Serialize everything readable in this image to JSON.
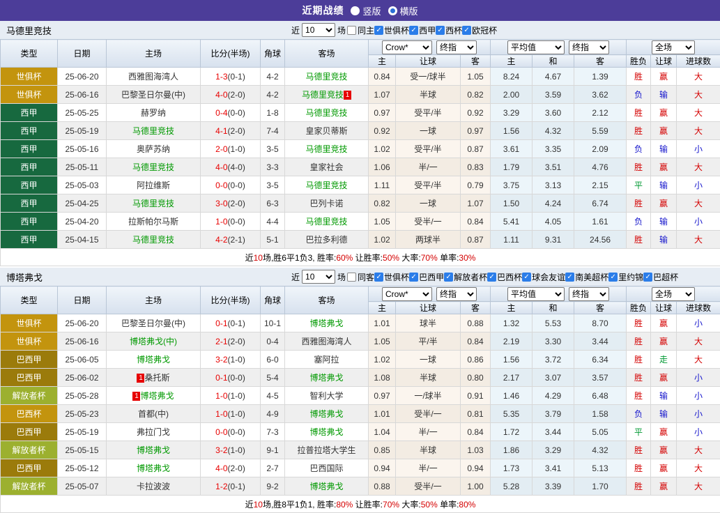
{
  "topbar": {
    "title": "近期战绩",
    "radios": [
      {
        "label": "竖版",
        "selected": false
      },
      {
        "label": "横版",
        "selected": true
      }
    ]
  },
  "colors": {
    "topbar_purple": "#4c3d99",
    "league_gold": "#c3940e",
    "league_green": "#17693f",
    "league_bronze": "#9b7b0b",
    "league_yellowgreen": "#9cb02f",
    "team_highlight_green": "#009900",
    "score_red": "#e80000",
    "result_red": "#d40000",
    "result_blue": "#1515cc",
    "result_green": "#009933"
  },
  "columns": {
    "type": "类型",
    "date": "日期",
    "home": "主场",
    "score": "比分(半场)",
    "corner": "角球",
    "away": "客场"
  },
  "dropdowns": {
    "crow": "Crow*",
    "final1": "终指",
    "avg": "平均值",
    "final2": "终指",
    "full": "全场"
  },
  "subheader": [
    "主",
    "让球",
    "客",
    "主",
    "和",
    "客",
    "胜负",
    "让球",
    "进球数"
  ],
  "filter_labels": {
    "near": "近",
    "games": "场"
  },
  "sections": [
    {
      "team": "马德里竞技",
      "filter": {
        "count": "10",
        "venue_label": "同主",
        "venue_checked": false,
        "leagues": [
          "世俱杯",
          "西甲",
          "西杯",
          "欧冠杯"
        ]
      },
      "rows": [
        {
          "league": "世俱杯",
          "lc": "gold",
          "date": "25-06-20",
          "home": "西雅图海湾人",
          "home_hl": false,
          "home_badge": "",
          "score": "1-3",
          "half": "(0-1)",
          "corner": "4-2",
          "away": "马德里竞技",
          "away_hl": true,
          "away_badge": "",
          "odds": [
            "0.84",
            "受一/球半",
            "1.05"
          ],
          "avg": [
            "8.24",
            "4.67",
            "1.39"
          ],
          "res": [
            [
              "胜",
              "r"
            ],
            [
              "赢",
              "r"
            ],
            [
              "大",
              "r"
            ]
          ]
        },
        {
          "league": "世俱杯",
          "lc": "gold",
          "date": "25-06-16",
          "home": "巴黎圣日尔曼(中)",
          "home_hl": false,
          "home_badge": "",
          "score": "4-0",
          "half": "(2-0)",
          "corner": "4-2",
          "away": "马德里竞技",
          "away_hl": true,
          "away_badge": "1",
          "odds": [
            "1.07",
            "半球",
            "0.82"
          ],
          "avg": [
            "2.00",
            "3.59",
            "3.62"
          ],
          "res": [
            [
              "负",
              "b"
            ],
            [
              "输",
              "b"
            ],
            [
              "大",
              "r"
            ]
          ]
        },
        {
          "league": "西甲",
          "lc": "green",
          "date": "25-05-25",
          "home": "赫罗纳",
          "home_hl": false,
          "home_badge": "",
          "score": "0-4",
          "half": "(0-0)",
          "corner": "1-8",
          "away": "马德里竞技",
          "away_hl": true,
          "away_badge": "",
          "odds": [
            "0.97",
            "受平/半",
            "0.92"
          ],
          "avg": [
            "3.29",
            "3.60",
            "2.12"
          ],
          "res": [
            [
              "胜",
              "r"
            ],
            [
              "赢",
              "r"
            ],
            [
              "大",
              "r"
            ]
          ]
        },
        {
          "league": "西甲",
          "lc": "green",
          "date": "25-05-19",
          "home": "马德里竞技",
          "home_hl": true,
          "home_badge": "",
          "score": "4-1",
          "half": "(2-0)",
          "corner": "7-4",
          "away": "皇家贝蒂斯",
          "away_hl": false,
          "away_badge": "",
          "odds": [
            "0.92",
            "一球",
            "0.97"
          ],
          "avg": [
            "1.56",
            "4.32",
            "5.59"
          ],
          "res": [
            [
              "胜",
              "r"
            ],
            [
              "赢",
              "r"
            ],
            [
              "大",
              "r"
            ]
          ]
        },
        {
          "league": "西甲",
          "lc": "green",
          "date": "25-05-16",
          "home": "奥萨苏纳",
          "home_hl": false,
          "home_badge": "",
          "score": "2-0",
          "half": "(1-0)",
          "corner": "3-5",
          "away": "马德里竞技",
          "away_hl": true,
          "away_badge": "",
          "odds": [
            "1.02",
            "受平/半",
            "0.87"
          ],
          "avg": [
            "3.61",
            "3.35",
            "2.09"
          ],
          "res": [
            [
              "负",
              "b"
            ],
            [
              "输",
              "b"
            ],
            [
              "小",
              "b"
            ]
          ]
        },
        {
          "league": "西甲",
          "lc": "green",
          "date": "25-05-11",
          "home": "马德里竞技",
          "home_hl": true,
          "home_badge": "",
          "score": "4-0",
          "half": "(4-0)",
          "corner": "3-3",
          "away": "皇家社会",
          "away_hl": false,
          "away_badge": "",
          "odds": [
            "1.06",
            "半/一",
            "0.83"
          ],
          "avg": [
            "1.79",
            "3.51",
            "4.76"
          ],
          "res": [
            [
              "胜",
              "r"
            ],
            [
              "赢",
              "r"
            ],
            [
              "大",
              "r"
            ]
          ]
        },
        {
          "league": "西甲",
          "lc": "green",
          "date": "25-05-03",
          "home": "阿拉维斯",
          "home_hl": false,
          "home_badge": "",
          "score": "0-0",
          "half": "(0-0)",
          "corner": "3-5",
          "away": "马德里竞技",
          "away_hl": true,
          "away_badge": "",
          "odds": [
            "1.11",
            "受平/半",
            "0.79"
          ],
          "avg": [
            "3.75",
            "3.13",
            "2.15"
          ],
          "res": [
            [
              "平",
              "g"
            ],
            [
              "输",
              "b"
            ],
            [
              "小",
              "b"
            ]
          ]
        },
        {
          "league": "西甲",
          "lc": "green",
          "date": "25-04-25",
          "home": "马德里竞技",
          "home_hl": true,
          "home_badge": "",
          "score": "3-0",
          "half": "(2-0)",
          "corner": "6-3",
          "away": "巴列卡诺",
          "away_hl": false,
          "away_badge": "",
          "odds": [
            "0.82",
            "一球",
            "1.07"
          ],
          "avg": [
            "1.50",
            "4.24",
            "6.74"
          ],
          "res": [
            [
              "胜",
              "r"
            ],
            [
              "赢",
              "r"
            ],
            [
              "大",
              "r"
            ]
          ]
        },
        {
          "league": "西甲",
          "lc": "green",
          "date": "25-04-20",
          "home": "拉斯帕尔马斯",
          "home_hl": false,
          "home_badge": "",
          "score": "1-0",
          "half": "(0-0)",
          "corner": "4-4",
          "away": "马德里竞技",
          "away_hl": true,
          "away_badge": "",
          "odds": [
            "1.05",
            "受半/一",
            "0.84"
          ],
          "avg": [
            "5.41",
            "4.05",
            "1.61"
          ],
          "res": [
            [
              "负",
              "b"
            ],
            [
              "输",
              "b"
            ],
            [
              "小",
              "b"
            ]
          ]
        },
        {
          "league": "西甲",
          "lc": "green",
          "date": "25-04-15",
          "home": "马德里竞技",
          "home_hl": true,
          "home_badge": "",
          "score": "4-2",
          "half": "(2-1)",
          "corner": "5-1",
          "away": "巴拉多利德",
          "away_hl": false,
          "away_badge": "",
          "odds": [
            "1.02",
            "两球半",
            "0.87"
          ],
          "avg": [
            "1.11",
            "9.31",
            "24.56"
          ],
          "res": [
            [
              "胜",
              "r"
            ],
            [
              "输",
              "b"
            ],
            [
              "大",
              "r"
            ]
          ]
        }
      ],
      "summary": [
        [
          "近",
          "k"
        ],
        [
          "10",
          "r"
        ],
        [
          "场,胜6平1负3, 胜率:",
          "k"
        ],
        [
          "60%",
          "r"
        ],
        [
          " 让胜率:",
          "k"
        ],
        [
          "50%",
          "r"
        ],
        [
          " 大率:",
          "k"
        ],
        [
          "70%",
          "r"
        ],
        [
          " 单率:",
          "k"
        ],
        [
          "30%",
          "r"
        ]
      ]
    },
    {
      "team": "博塔弗戈",
      "filter": {
        "count": "10",
        "venue_label": "同客",
        "venue_checked": false,
        "leagues": [
          "世俱杯",
          "巴西甲",
          "解放者杯",
          "巴西杯",
          "球会友谊",
          "南美超杯",
          "里约锦",
          "巴超杯"
        ]
      },
      "rows": [
        {
          "league": "世俱杯",
          "lc": "gold",
          "date": "25-06-20",
          "home": "巴黎圣日尔曼(中)",
          "home_hl": false,
          "home_badge": "",
          "score": "0-1",
          "half": "(0-1)",
          "corner": "10-1",
          "away": "博塔弗戈",
          "away_hl": true,
          "away_badge": "",
          "odds": [
            "1.01",
            "球半",
            "0.88"
          ],
          "avg": [
            "1.32",
            "5.53",
            "8.70"
          ],
          "res": [
            [
              "胜",
              "r"
            ],
            [
              "赢",
              "r"
            ],
            [
              "小",
              "b"
            ]
          ]
        },
        {
          "league": "世俱杯",
          "lc": "gold",
          "date": "25-06-16",
          "home": "博塔弗戈(中)",
          "home_hl": true,
          "home_badge": "",
          "score": "2-1",
          "half": "(2-0)",
          "corner": "0-4",
          "away": "西雅图海湾人",
          "away_hl": false,
          "away_badge": "",
          "odds": [
            "1.05",
            "平/半",
            "0.84"
          ],
          "avg": [
            "2.19",
            "3.30",
            "3.44"
          ],
          "res": [
            [
              "胜",
              "r"
            ],
            [
              "赢",
              "r"
            ],
            [
              "大",
              "r"
            ]
          ]
        },
        {
          "league": "巴西甲",
          "lc": "bronze",
          "date": "25-06-05",
          "home": "博塔弗戈",
          "home_hl": true,
          "home_badge": "",
          "score": "3-2",
          "half": "(1-0)",
          "corner": "6-0",
          "away": "塞阿拉",
          "away_hl": false,
          "away_badge": "",
          "odds": [
            "1.02",
            "一球",
            "0.86"
          ],
          "avg": [
            "1.56",
            "3.72",
            "6.34"
          ],
          "res": [
            [
              "胜",
              "r"
            ],
            [
              "走",
              "g"
            ],
            [
              "大",
              "r"
            ]
          ]
        },
        {
          "league": "巴西甲",
          "lc": "bronze",
          "date": "25-06-02",
          "home": "桑托斯",
          "home_hl": false,
          "home_badge": "1",
          "score": "0-1",
          "half": "(0-0)",
          "corner": "5-4",
          "away": "博塔弗戈",
          "away_hl": true,
          "away_badge": "",
          "odds": [
            "1.08",
            "半球",
            "0.80"
          ],
          "avg": [
            "2.17",
            "3.07",
            "3.57"
          ],
          "res": [
            [
              "胜",
              "r"
            ],
            [
              "赢",
              "r"
            ],
            [
              "小",
              "b"
            ]
          ]
        },
        {
          "league": "解放者杯",
          "lc": "yg",
          "date": "25-05-28",
          "home": "博塔弗戈",
          "home_hl": true,
          "home_badge": "1",
          "score": "1-0",
          "half": "(1-0)",
          "corner": "4-5",
          "away": "智利大学",
          "away_hl": false,
          "away_badge": "",
          "odds": [
            "0.97",
            "一/球半",
            "0.91"
          ],
          "avg": [
            "1.46",
            "4.29",
            "6.48"
          ],
          "res": [
            [
              "胜",
              "r"
            ],
            [
              "输",
              "b"
            ],
            [
              "小",
              "b"
            ]
          ]
        },
        {
          "league": "巴西杯",
          "lc": "gold",
          "date": "25-05-23",
          "home": "首都(中)",
          "home_hl": false,
          "home_badge": "",
          "score": "1-0",
          "half": "(1-0)",
          "corner": "4-9",
          "away": "博塔弗戈",
          "away_hl": true,
          "away_badge": "",
          "odds": [
            "1.01",
            "受半/一",
            "0.81"
          ],
          "avg": [
            "5.35",
            "3.79",
            "1.58"
          ],
          "res": [
            [
              "负",
              "b"
            ],
            [
              "输",
              "b"
            ],
            [
              "小",
              "b"
            ]
          ]
        },
        {
          "league": "巴西甲",
          "lc": "bronze",
          "date": "25-05-19",
          "home": "弗拉门戈",
          "home_hl": false,
          "home_badge": "",
          "score": "0-0",
          "half": "(0-0)",
          "corner": "7-3",
          "away": "博塔弗戈",
          "away_hl": true,
          "away_badge": "",
          "odds": [
            "1.04",
            "半/一",
            "0.84"
          ],
          "avg": [
            "1.72",
            "3.44",
            "5.05"
          ],
          "res": [
            [
              "平",
              "g"
            ],
            [
              "赢",
              "r"
            ],
            [
              "小",
              "b"
            ]
          ]
        },
        {
          "league": "解放者杯",
          "lc": "yg",
          "date": "25-05-15",
          "home": "博塔弗戈",
          "home_hl": true,
          "home_badge": "",
          "score": "3-2",
          "half": "(1-0)",
          "corner": "9-1",
          "away": "拉普拉塔大学生",
          "away_hl": false,
          "away_badge": "",
          "odds": [
            "0.85",
            "半球",
            "1.03"
          ],
          "avg": [
            "1.86",
            "3.29",
            "4.32"
          ],
          "res": [
            [
              "胜",
              "r"
            ],
            [
              "赢",
              "r"
            ],
            [
              "大",
              "r"
            ]
          ]
        },
        {
          "league": "巴西甲",
          "lc": "bronze",
          "date": "25-05-12",
          "home": "博塔弗戈",
          "home_hl": true,
          "home_badge": "",
          "score": "4-0",
          "half": "(2-0)",
          "corner": "2-7",
          "away": "巴西国际",
          "away_hl": false,
          "away_badge": "",
          "odds": [
            "0.94",
            "半/一",
            "0.94"
          ],
          "avg": [
            "1.73",
            "3.41",
            "5.13"
          ],
          "res": [
            [
              "胜",
              "r"
            ],
            [
              "赢",
              "r"
            ],
            [
              "大",
              "r"
            ]
          ]
        },
        {
          "league": "解放者杯",
          "lc": "yg",
          "date": "25-05-07",
          "home": "卡拉波波",
          "home_hl": false,
          "home_badge": "",
          "score": "1-2",
          "half": "(0-1)",
          "corner": "9-2",
          "away": "博塔弗戈",
          "away_hl": true,
          "away_badge": "",
          "odds": [
            "0.88",
            "受半/一",
            "1.00"
          ],
          "avg": [
            "5.28",
            "3.39",
            "1.70"
          ],
          "res": [
            [
              "胜",
              "r"
            ],
            [
              "赢",
              "r"
            ],
            [
              "大",
              "r"
            ]
          ]
        }
      ],
      "summary": [
        [
          "近",
          "k"
        ],
        [
          "10",
          "r"
        ],
        [
          "场,胜8平1负1, 胜率:",
          "k"
        ],
        [
          "80%",
          "r"
        ],
        [
          " 让胜率:",
          "k"
        ],
        [
          "70%",
          "r"
        ],
        [
          " 大率:",
          "k"
        ],
        [
          "50%",
          "r"
        ],
        [
          " 单率:",
          "k"
        ],
        [
          "80%",
          "r"
        ]
      ]
    }
  ]
}
